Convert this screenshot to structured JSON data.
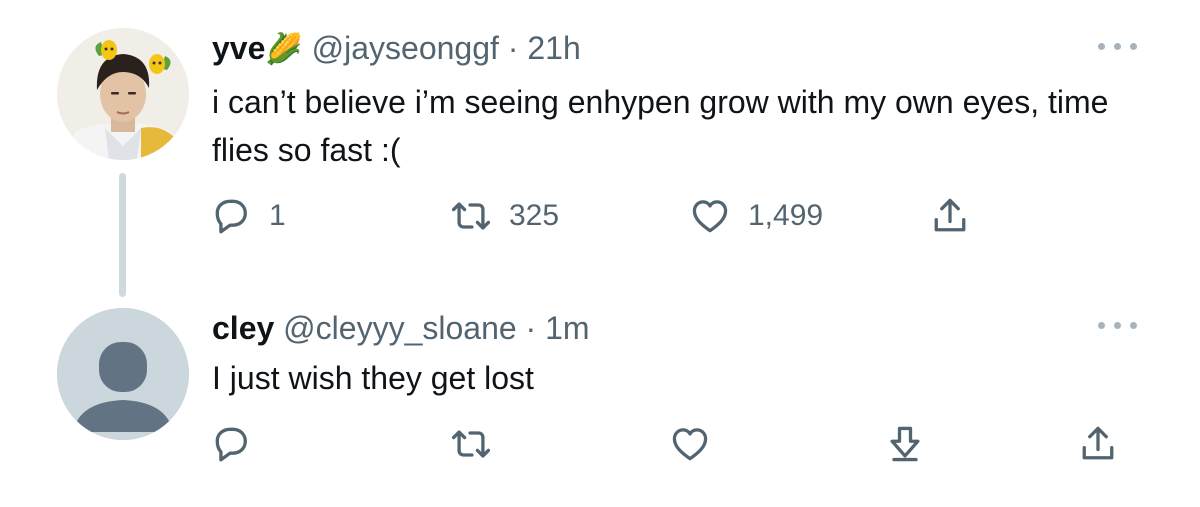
{
  "tweets": [
    {
      "name": "yve",
      "name_emoji": "🌽",
      "handle": "@jayseonggf",
      "separator": "·",
      "time": "21h",
      "text": "i can’t believe i’m seeing enhypen grow with my own eyes, time flies so fast :(",
      "actions": {
        "reply_count": "1",
        "retweet_count": "325",
        "like_count": "1,499"
      }
    },
    {
      "name": "cley",
      "handle": "@cleyyy_sloane",
      "separator": "·",
      "time": "1m",
      "text": "I just wish they get lost"
    }
  ],
  "icons": {
    "reply": "reply-icon",
    "retweet": "retweet-icon",
    "like": "like-icon",
    "share": "share-icon",
    "download": "download-icon",
    "more": "more-icon"
  },
  "colors": {
    "text_primary": "#0f1419",
    "text_secondary": "#536471",
    "thread_line": "#cfd9de",
    "default_avatar_bg": "#ccd6dd",
    "default_avatar_fg": "#627483"
  }
}
